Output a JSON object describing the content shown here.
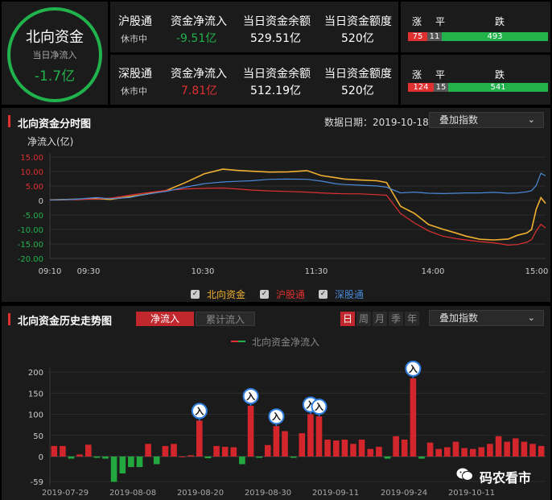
{
  "summary": {
    "title": "北向资金",
    "sub": "当日净流入",
    "value": "-1.7亿",
    "headers": [
      "资金净流入",
      "当日资金余额",
      "当日资金额度"
    ],
    "rows": [
      {
        "name": "沪股通",
        "status": "休市中",
        "net": "-9.51亿",
        "balance": "529.51亿",
        "quota": "520亿",
        "breadth": {
          "up": "75",
          "flat": "11",
          "down": "493",
          "up_n": 75,
          "flat_n": 11,
          "down_n": 493
        }
      },
      {
        "name": "深股通",
        "status": "休市中",
        "net": "7.81亿",
        "balance": "512.19亿",
        "quota": "520亿",
        "breadth": {
          "up": "124",
          "flat": "15",
          "down": "541",
          "up_n": 124,
          "flat_n": 15,
          "down_n": 541
        }
      }
    ],
    "breadth_labels": {
      "up": "涨",
      "flat": "平",
      "down": "跌"
    }
  },
  "colors": {
    "red": "#e03030",
    "green": "#22b24c",
    "gold": "#f0b030",
    "blue": "#4a8ad8",
    "grey": "#555555"
  },
  "intraday": {
    "title": "北向资金分时图",
    "date_label": "数据日期：2019-10-18",
    "overlay_select": "叠加指数",
    "chart_data": {
      "type": "line",
      "ylabel": "净流入(亿)",
      "ylim": [
        -20,
        15
      ],
      "yticks": [
        "15.00",
        "10.00",
        "5.00",
        "0",
        "-5.00",
        "-10.00",
        "-15.00",
        "-20.00"
      ],
      "xticks": [
        "09:10",
        "09:30",
        "10:30",
        "11:30",
        "14:00",
        "15:00"
      ],
      "series": [
        {
          "name": "北向资金",
          "color": "#f0b030",
          "points": [
            [
              0,
              0.2
            ],
            [
              5,
              0.4
            ],
            [
              10,
              0.6
            ],
            [
              13,
              0.4
            ],
            [
              17,
              1.3
            ],
            [
              20,
              2.0
            ],
            [
              25,
              3.5
            ],
            [
              29,
              6.2
            ],
            [
              33,
              9.2
            ],
            [
              37,
              10.8
            ],
            [
              40,
              10.4
            ],
            [
              43,
              10.1
            ],
            [
              47,
              9.8
            ],
            [
              51,
              9.9
            ],
            [
              55,
              10.3
            ],
            [
              58,
              8.6
            ],
            [
              61,
              7.9
            ],
            [
              63,
              7.4
            ],
            [
              66,
              7.1
            ],
            [
              70,
              6.8
            ],
            [
              72,
              6.2
            ],
            [
              75,
              -2.0
            ],
            [
              78,
              -4.5
            ],
            [
              81,
              -8.3
            ],
            [
              84,
              -9.9
            ],
            [
              87,
              -11.3
            ],
            [
              89,
              -12.3
            ],
            [
              92,
              -13.4
            ],
            [
              95,
              -13.6
            ],
            [
              98,
              -13.3
            ],
            [
              100,
              -12.0
            ],
            [
              102,
              -11.2
            ],
            [
              103,
              -10.0
            ],
            [
              104,
              -3.0
            ],
            [
              105,
              1.0
            ],
            [
              106,
              -1.0
            ]
          ]
        },
        {
          "name": "沪股通",
          "color": "#e03030",
          "points": [
            [
              0,
              0.2
            ],
            [
              5,
              0.3
            ],
            [
              10,
              0.5
            ],
            [
              13,
              0.8
            ],
            [
              17,
              1.8
            ],
            [
              20,
              2.5
            ],
            [
              25,
              3.5
            ],
            [
              29,
              4.0
            ],
            [
              33,
              4.2
            ],
            [
              37,
              4.3
            ],
            [
              40,
              4.0
            ],
            [
              43,
              3.6
            ],
            [
              47,
              3.3
            ],
            [
              51,
              3.1
            ],
            [
              55,
              2.9
            ],
            [
              58,
              2.6
            ],
            [
              61,
              2.4
            ],
            [
              63,
              2.3
            ],
            [
              66,
              2.3
            ],
            [
              70,
              2.0
            ],
            [
              72,
              1.8
            ],
            [
              75,
              -4.5
            ],
            [
              78,
              -7.8
            ],
            [
              81,
              -10.5
            ],
            [
              84,
              -12.3
            ],
            [
              87,
              -13.2
            ],
            [
              89,
              -13.6
            ],
            [
              92,
              -14.2
            ],
            [
              95,
              -14.6
            ],
            [
              98,
              -15.4
            ],
            [
              100,
              -15.2
            ],
            [
              102,
              -14.4
            ],
            [
              103,
              -13.5
            ],
            [
              104,
              -10.5
            ],
            [
              105,
              -8.2
            ],
            [
              106,
              -9.5
            ]
          ]
        },
        {
          "name": "深股通",
          "color": "#4a8ad8",
          "points": [
            [
              0,
              0.2
            ],
            [
              5,
              0.4
            ],
            [
              10,
              1.0
            ],
            [
              13,
              0.6
            ],
            [
              17,
              1.0
            ],
            [
              20,
              2.0
            ],
            [
              25,
              3.2
            ],
            [
              29,
              4.6
            ],
            [
              33,
              5.8
            ],
            [
              37,
              6.4
            ],
            [
              40,
              6.6
            ],
            [
              43,
              6.8
            ],
            [
              47,
              7.3
            ],
            [
              51,
              7.4
            ],
            [
              55,
              7.3
            ],
            [
              58,
              6.7
            ],
            [
              61,
              5.8
            ],
            [
              63,
              5.5
            ],
            [
              66,
              5.3
            ],
            [
              70,
              5.0
            ],
            [
              72,
              4.6
            ],
            [
              75,
              2.6
            ],
            [
              78,
              2.9
            ],
            [
              81,
              2.5
            ],
            [
              84,
              2.4
            ],
            [
              87,
              2.5
            ],
            [
              89,
              2.6
            ],
            [
              92,
              2.6
            ],
            [
              95,
              2.8
            ],
            [
              98,
              2.5
            ],
            [
              100,
              2.6
            ],
            [
              102,
              3.0
            ],
            [
              103,
              3.4
            ],
            [
              104,
              5.2
            ],
            [
              105,
              9.4
            ],
            [
              106,
              8.5
            ]
          ]
        }
      ]
    },
    "legend_check": "✓"
  },
  "history": {
    "title": "北向资金历史走势图",
    "tabs": [
      "净流入",
      "累计流入"
    ],
    "periods": [
      "日",
      "周",
      "月",
      "季",
      "年"
    ],
    "overlay_select": "叠加指数",
    "marker_label": "入",
    "watermark": "码农看市",
    "chart_data": {
      "type": "bar",
      "legend": "北向资金净流入",
      "ylim": [
        -65,
        215
      ],
      "yticks": [
        "200",
        "150",
        "100",
        "50",
        "0",
        "-59"
      ],
      "xticks": [
        "2019-07-29",
        "2019-08-08",
        "2019-08-20",
        "2019-08-30",
        "2019-09-11",
        "2019-09-24",
        "2019-10-11"
      ],
      "values": [
        25,
        25,
        -5,
        5,
        28,
        -3,
        -5,
        -60,
        -40,
        -25,
        -25,
        30,
        -18,
        25,
        30,
        0,
        3,
        85,
        -4,
        25,
        23,
        22,
        -18,
        120,
        -3,
        27,
        72,
        60,
        -3,
        55,
        100,
        95,
        40,
        38,
        40,
        30,
        40,
        18,
        23,
        -5,
        48,
        40,
        185,
        -5,
        33,
        18,
        22,
        35,
        20,
        18,
        22,
        30,
        48,
        35,
        43,
        35,
        30,
        25
      ]
    }
  }
}
